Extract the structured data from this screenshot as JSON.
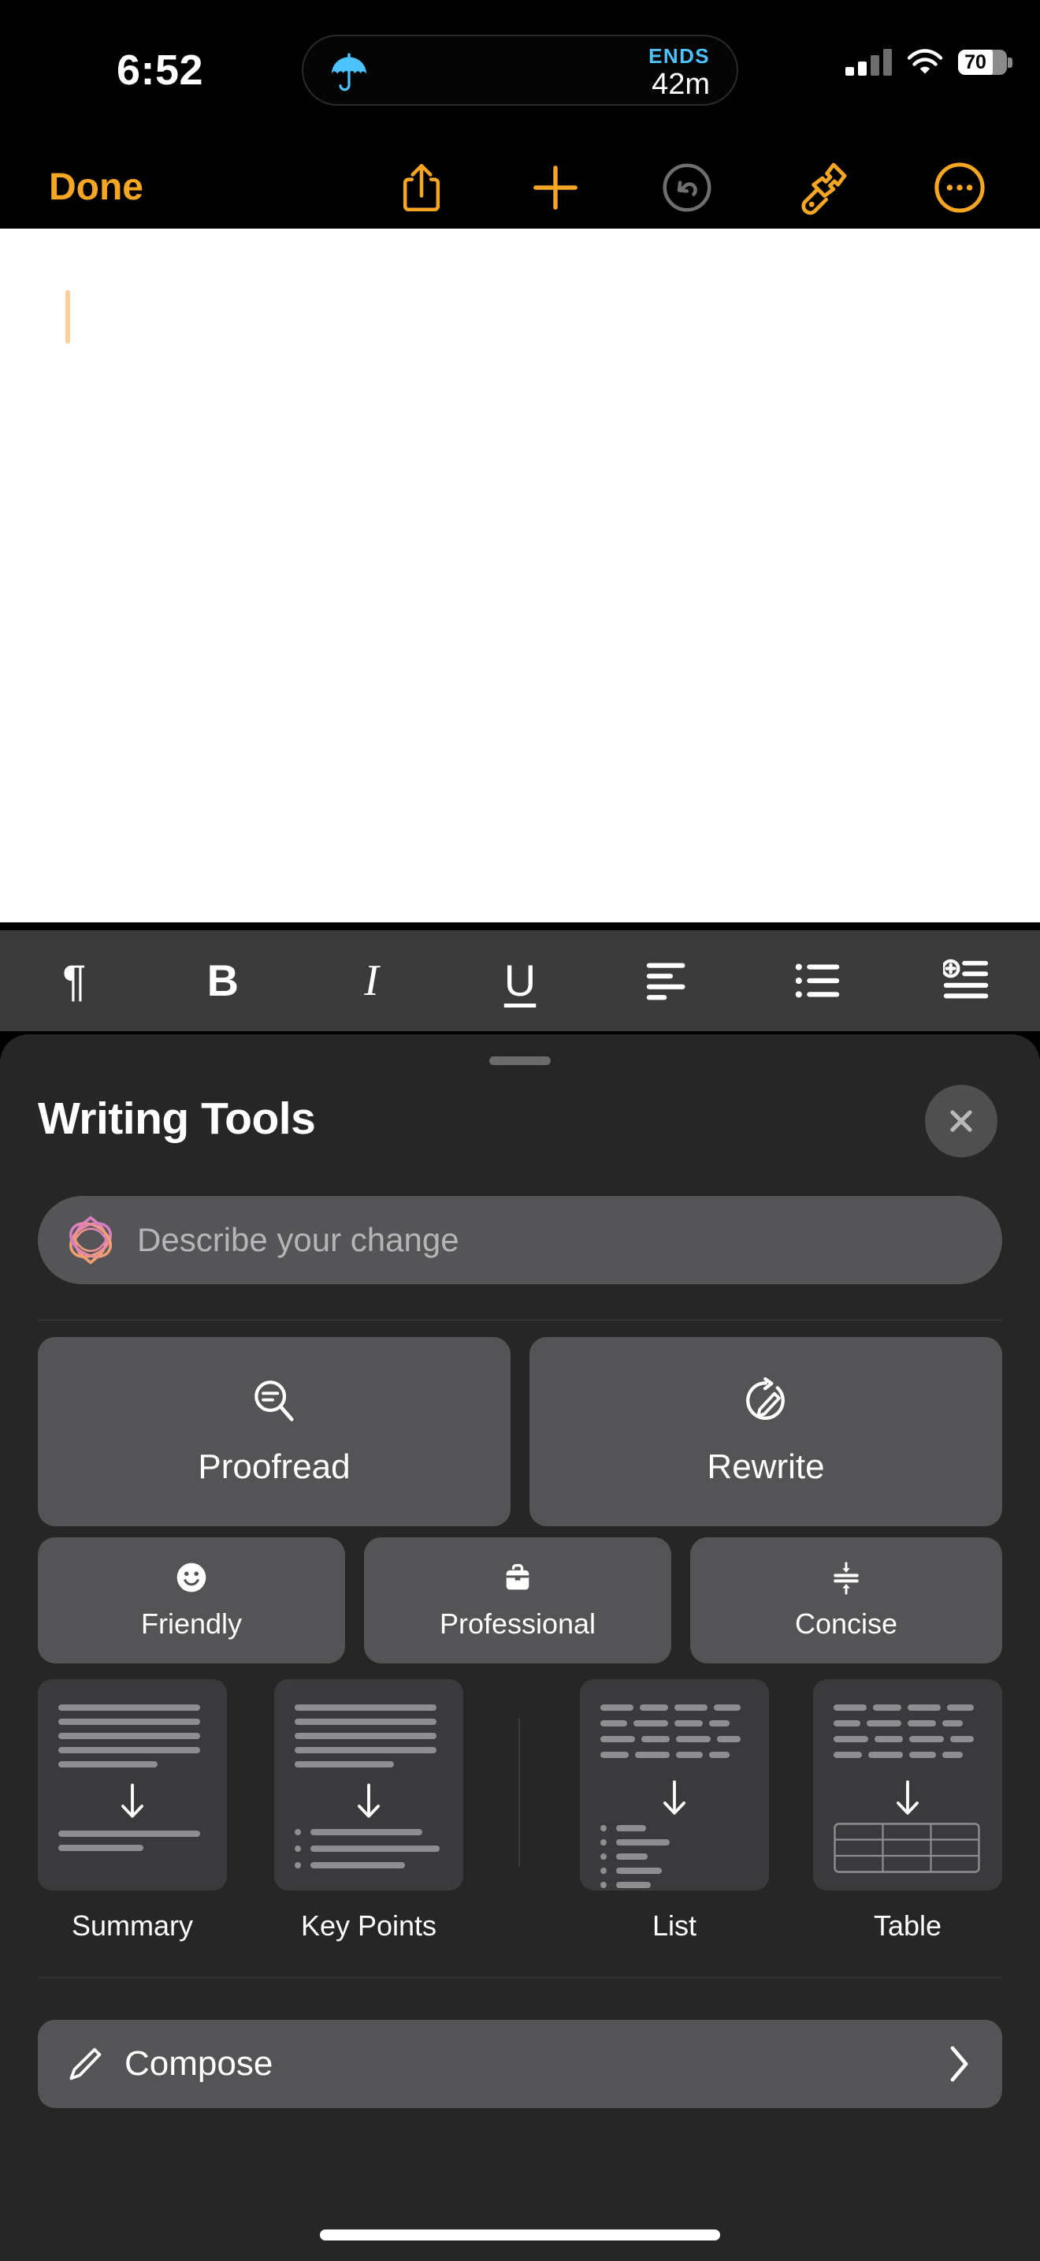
{
  "status_bar": {
    "time": "6:52",
    "dynamic_island": {
      "icon": "umbrella-icon",
      "label": "ENDS",
      "value": "42m"
    },
    "cellular_icon": "cellular-signal-icon",
    "cellular_bars_active": 2,
    "cellular_bars_total": 4,
    "wifi_icon": "wifi-icon",
    "battery_percent": "70",
    "battery_icon": "battery-icon",
    "colors": {
      "ends_label": "#4cc2ff",
      "battery_fill": "#ffffff",
      "battery_track": "#8b8b8b"
    }
  },
  "nav_toolbar": {
    "done_label": "Done",
    "accent_color": "#f5a623",
    "items": [
      {
        "name": "share-icon",
        "label": "Share"
      },
      {
        "name": "add-icon",
        "label": "Add"
      },
      {
        "name": "undo-icon",
        "label": "Undo",
        "disabled": true
      },
      {
        "name": "markup-brush-icon",
        "label": "Markup"
      },
      {
        "name": "more-ellipsis-icon",
        "label": "More"
      }
    ]
  },
  "note": {
    "body_text": "",
    "cursor_color": "#f8cf9a"
  },
  "format_toolbar": {
    "items": [
      {
        "name": "paragraph-style-icon",
        "glyph": "¶",
        "label": "Paragraph Style"
      },
      {
        "name": "bold-icon",
        "glyph": "B",
        "label": "Bold"
      },
      {
        "name": "italic-icon",
        "glyph": "I",
        "label": "Italic"
      },
      {
        "name": "underline-icon",
        "glyph": "U",
        "label": "Underline"
      },
      {
        "name": "align-left-icon",
        "glyph": "",
        "label": "Align Left"
      },
      {
        "name": "bulleted-list-icon",
        "glyph": "",
        "label": "Bulleted List"
      },
      {
        "name": "add-list-item-icon",
        "glyph": "",
        "label": "Insert List Item"
      }
    ]
  },
  "writing_tools": {
    "title": "Writing Tools",
    "close_label": "Close",
    "prompt": {
      "placeholder": "Describe your change",
      "value": "",
      "icon": "apple-intelligence-icon"
    },
    "primary_actions": [
      {
        "label": "Proofread",
        "icon": "magnifier-text-icon"
      },
      {
        "label": "Rewrite",
        "icon": "circle-pencil-icon"
      }
    ],
    "tone_actions": [
      {
        "label": "Friendly",
        "icon": "smiley-face-icon"
      },
      {
        "label": "Professional",
        "icon": "briefcase-icon"
      },
      {
        "label": "Concise",
        "icon": "compress-arrows-icon"
      }
    ],
    "transform_cards": [
      {
        "label": "Summary",
        "art": "paragraph-to-short-paragraph"
      },
      {
        "label": "Key Points",
        "art": "paragraph-to-bullets"
      },
      {
        "label": "List",
        "art": "words-to-list"
      },
      {
        "label": "Table",
        "art": "words-to-table"
      }
    ],
    "compose": {
      "label": "Compose",
      "icon": "pencil-icon",
      "chevron": "chevron-right-icon"
    }
  },
  "home_indicator": {
    "name": "home-indicator"
  }
}
